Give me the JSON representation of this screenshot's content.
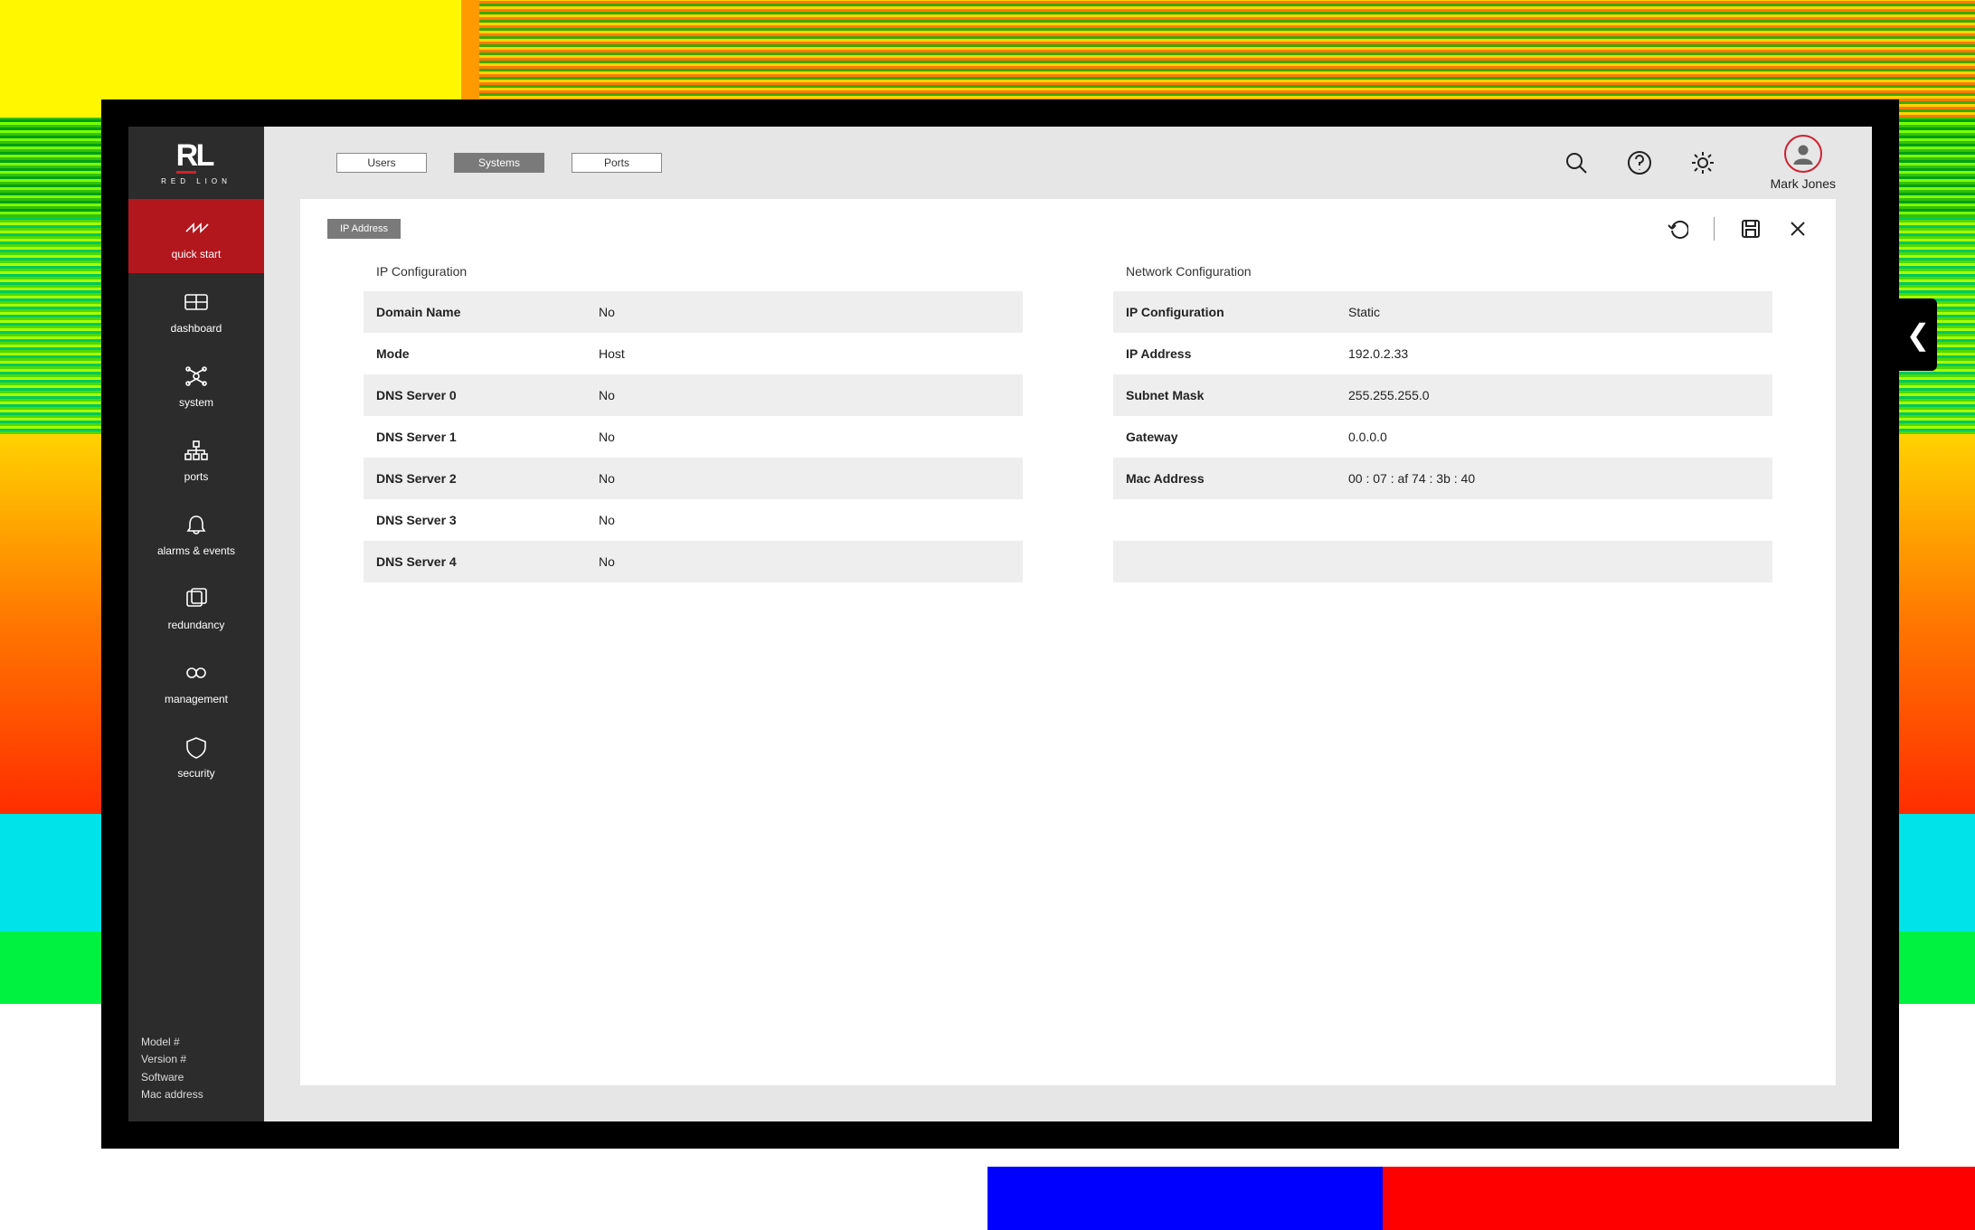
{
  "brand": {
    "name": "RL",
    "sub": "RED LION"
  },
  "sidebar": {
    "items": [
      {
        "label": "quick start"
      },
      {
        "label": "dashboard"
      },
      {
        "label": "system"
      },
      {
        "label": "ports"
      },
      {
        "label": "alarms & events"
      },
      {
        "label": "redundancy"
      },
      {
        "label": "management"
      },
      {
        "label": "security"
      }
    ],
    "footer": [
      "Model #",
      "Version #",
      "Software",
      "Mac address"
    ]
  },
  "topbar": {
    "tabs": [
      "Users",
      "Systems",
      "Ports"
    ],
    "user": "Mark Jones"
  },
  "subtab": "IP Address",
  "ipConfig": {
    "title": "IP Configuration",
    "rows": [
      {
        "k": "Domain Name",
        "v": "No"
      },
      {
        "k": "Mode",
        "v": "Host"
      },
      {
        "k": "DNS Server 0",
        "v": "No"
      },
      {
        "k": "DNS Server 1",
        "v": "No"
      },
      {
        "k": "DNS Server 2",
        "v": "No"
      },
      {
        "k": "DNS Server 3",
        "v": "No"
      },
      {
        "k": "DNS Server 4",
        "v": "No"
      }
    ]
  },
  "netConfig": {
    "title": "Network Configuration",
    "rows": [
      {
        "k": "IP Configuration",
        "v": "Static"
      },
      {
        "k": "IP Address",
        "v": "192.0.2.33"
      },
      {
        "k": "Subnet Mask",
        "v": "255.255.255.0"
      },
      {
        "k": "Gateway",
        "v": "0.0.0.0"
      },
      {
        "k": "Mac Address",
        "v": "00 : 07 : af 74 : 3b : 40"
      },
      {
        "k": "",
        "v": ""
      },
      {
        "k": "",
        "v": ""
      }
    ]
  }
}
